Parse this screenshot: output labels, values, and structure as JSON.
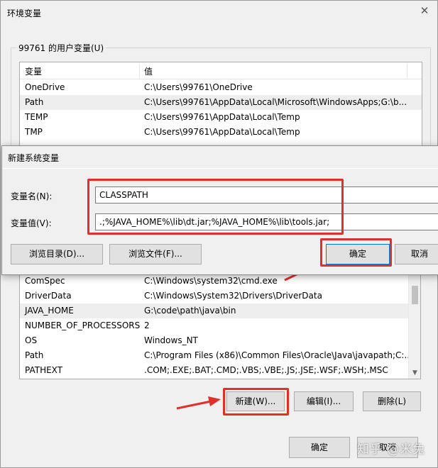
{
  "window": {
    "title": "环境变量",
    "close_glyph": "✕"
  },
  "user_vars": {
    "group_label": "99761 的用户变量(U)",
    "columns": [
      "变量",
      "值"
    ],
    "rows": [
      {
        "name": "OneDrive",
        "value": "C:\\Users\\99761\\OneDrive"
      },
      {
        "name": "Path",
        "value": "C:\\Users\\99761\\AppData\\Local\\Microsoft\\WindowsApps;G:\\b..."
      },
      {
        "name": "TEMP",
        "value": "C:\\Users\\99761\\AppData\\Local\\Temp"
      },
      {
        "name": "TMP",
        "value": "C:\\Users\\99761\\AppData\\Local\\Temp"
      }
    ]
  },
  "dialog": {
    "title": "新建系统变量",
    "name_label": "变量名(N):",
    "name_value": "CLASSPATH",
    "value_label": "变量值(V):",
    "value_value": ".;%JAVA_HOME%\\lib\\dt.jar;%JAVA_HOME%\\lib\\tools.jar;",
    "browse_dir": "浏览目录(D)...",
    "browse_file": "浏览文件(F)...",
    "ok": "确定",
    "cancel": "取消"
  },
  "system_vars": {
    "rows": [
      {
        "name": "ComSpec",
        "value": "C:\\Windows\\system32\\cmd.exe"
      },
      {
        "name": "DriverData",
        "value": "C:\\Windows\\System32\\Drivers\\DriverData"
      },
      {
        "name": "JAVA_HOME",
        "value": "G:\\code\\path\\java\\bin"
      },
      {
        "name": "NUMBER_OF_PROCESSORS",
        "value": "2"
      },
      {
        "name": "OS",
        "value": "Windows_NT"
      },
      {
        "name": "Path",
        "value": "C:\\Program Files (x86)\\Common Files\\Oracle\\Java\\javapath;C:..."
      },
      {
        "name": "PATHEXT",
        "value": ".COM;.EXE;.BAT;.CMD;.VBS;.VBE;.JS;.JSE;.WSF;.WSH;.MSC"
      }
    ],
    "new_button": "新建(W)...",
    "edit_button": "编辑(I)...",
    "delete_button": "删除(L)"
  },
  "footer": {
    "ok": "确定",
    "cancel": "取消"
  },
  "watermark": "知乎 @米兔",
  "colors": {
    "highlight": "#e0302a",
    "dialog_bg": "#f0f0f0",
    "focus_border": "#0078d7"
  }
}
